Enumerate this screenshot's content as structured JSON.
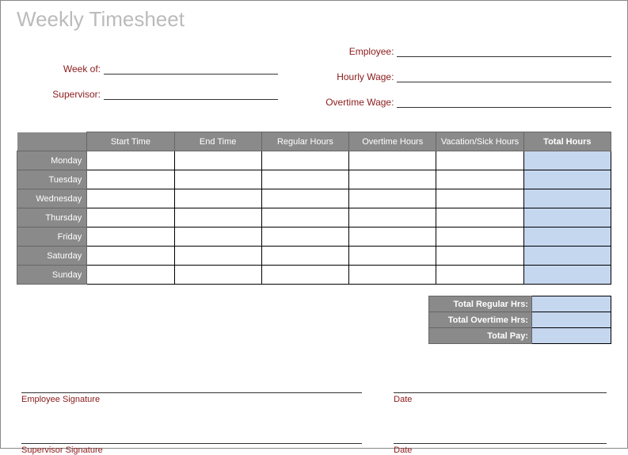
{
  "title": "Weekly Timesheet",
  "fields": {
    "week_of": "Week of:",
    "supervisor": "Supervisor:",
    "employee": "Employee:",
    "hourly_wage": "Hourly Wage:",
    "overtime_wage": "Overtime Wage:"
  },
  "columns": {
    "start_time": "Start Time",
    "end_time": "End Time",
    "regular_hours": "Regular Hours",
    "overtime_hours": "Overtime Hours",
    "vacation_sick": "Vacation/Sick Hours",
    "total_hours": "Total Hours"
  },
  "days": [
    "Monday",
    "Tuesday",
    "Wednesday",
    "Thursday",
    "Friday",
    "Saturday",
    "Sunday"
  ],
  "summary": {
    "total_regular": "Total Regular Hrs:",
    "total_overtime": "Total Overtime Hrs:",
    "total_pay": "Total Pay:"
  },
  "signatures": {
    "employee": "Employee Signature",
    "supervisor": "Supervisor Signature",
    "date": "Date"
  }
}
